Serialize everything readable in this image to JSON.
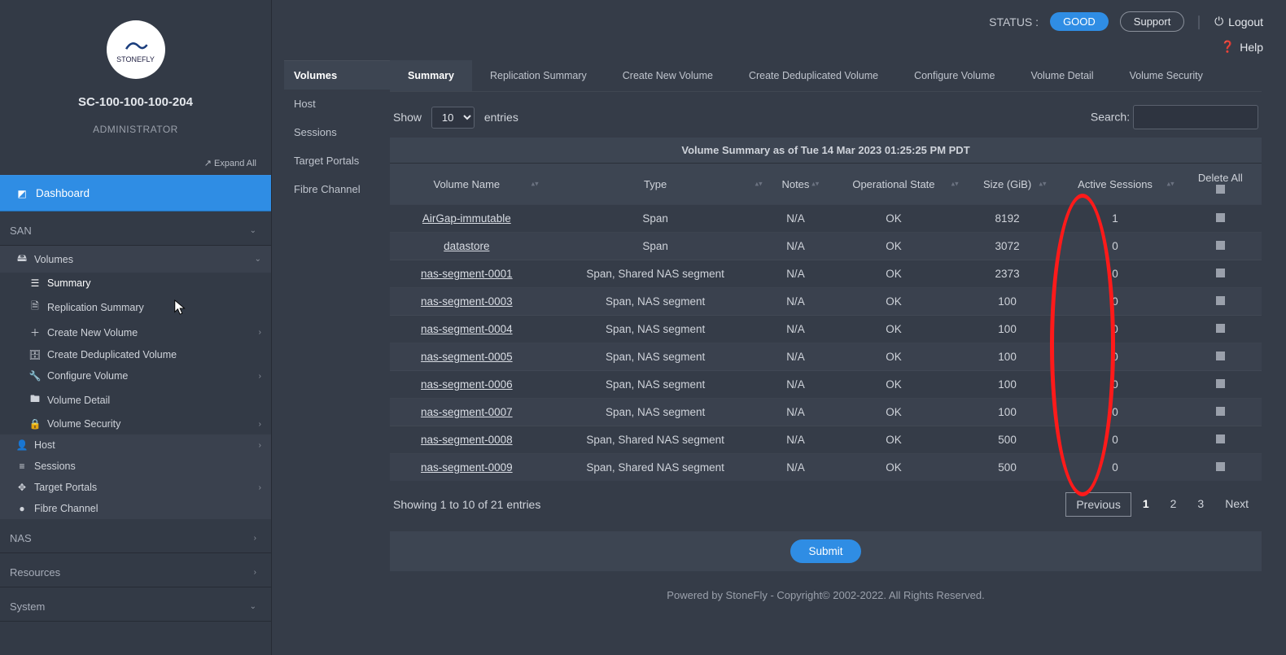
{
  "topbar": {
    "status_label": "STATUS :",
    "status_value": "GOOD",
    "support": "Support",
    "logout": "Logout",
    "help": "Help"
  },
  "sidebar": {
    "logo_text": "STONEFLY",
    "hostname": "SC-100-100-100-204",
    "role": "ADMINISTRATOR",
    "expand_all": "Expand All",
    "dashboard": "Dashboard",
    "sections": {
      "san": "SAN",
      "nas": "NAS",
      "resources": "Resources",
      "system": "System"
    },
    "volumes": "Volumes",
    "tree": {
      "summary": "Summary",
      "replication": "Replication Summary",
      "create_new": "Create New Volume",
      "create_dedup": "Create Deduplicated Volume",
      "configure": "Configure Volume",
      "detail": "Volume Detail",
      "security": "Volume Security"
    },
    "host": "Host",
    "sessions": "Sessions",
    "target_portals": "Target Portals",
    "fibre": "Fibre Channel"
  },
  "sidetabs": {
    "volumes": "Volumes",
    "host": "Host",
    "sessions": "Sessions",
    "target_portals": "Target Portals",
    "fibre": "Fibre Channel"
  },
  "htabs": {
    "summary": "Summary",
    "replication": "Replication Summary",
    "create_new": "Create New Volume",
    "create_dedup": "Create Deduplicated Volume",
    "configure": "Configure Volume",
    "detail": "Volume Detail",
    "security": "Volume Security"
  },
  "table": {
    "show_label": "Show",
    "show_value": "10",
    "entries_label": "entries",
    "search_label": "Search:",
    "title": "Volume Summary as of Tue 14 Mar 2023 01:25:25 PM PDT",
    "cols": {
      "name": "Volume Name",
      "type": "Type",
      "notes": "Notes",
      "state": "Operational State",
      "size": "Size (GiB)",
      "sessions": "Active Sessions",
      "delete": "Delete All"
    },
    "rows": [
      {
        "name": "AirGap-immutable",
        "type": "Span",
        "notes": "N/A",
        "state": "OK",
        "size": "8192",
        "sessions": "1"
      },
      {
        "name": "datastore",
        "type": "Span",
        "notes": "N/A",
        "state": "OK",
        "size": "3072",
        "sessions": "0"
      },
      {
        "name": "nas-segment-0001",
        "type": "Span, Shared NAS segment",
        "notes": "N/A",
        "state": "OK",
        "size": "2373",
        "sessions": "0"
      },
      {
        "name": "nas-segment-0003",
        "type": "Span, NAS segment",
        "notes": "N/A",
        "state": "OK",
        "size": "100",
        "sessions": "0"
      },
      {
        "name": "nas-segment-0004",
        "type": "Span, NAS segment",
        "notes": "N/A",
        "state": "OK",
        "size": "100",
        "sessions": "0"
      },
      {
        "name": "nas-segment-0005",
        "type": "Span, NAS segment",
        "notes": "N/A",
        "state": "OK",
        "size": "100",
        "sessions": "0"
      },
      {
        "name": "nas-segment-0006",
        "type": "Span, NAS segment",
        "notes": "N/A",
        "state": "OK",
        "size": "100",
        "sessions": "0"
      },
      {
        "name": "nas-segment-0007",
        "type": "Span, NAS segment",
        "notes": "N/A",
        "state": "OK",
        "size": "100",
        "sessions": "0"
      },
      {
        "name": "nas-segment-0008",
        "type": "Span, Shared NAS segment",
        "notes": "N/A",
        "state": "OK",
        "size": "500",
        "sessions": "0"
      },
      {
        "name": "nas-segment-0009",
        "type": "Span, Shared NAS segment",
        "notes": "N/A",
        "state": "OK",
        "size": "500",
        "sessions": "0"
      }
    ],
    "showing": "Showing 1 to 10 of 21 entries"
  },
  "pager": {
    "prev": "Previous",
    "p1": "1",
    "p2": "2",
    "p3": "3",
    "next": "Next"
  },
  "submit": "Submit",
  "footer": "Powered by StoneFly - Copyright© 2002-2022. All Rights Reserved."
}
